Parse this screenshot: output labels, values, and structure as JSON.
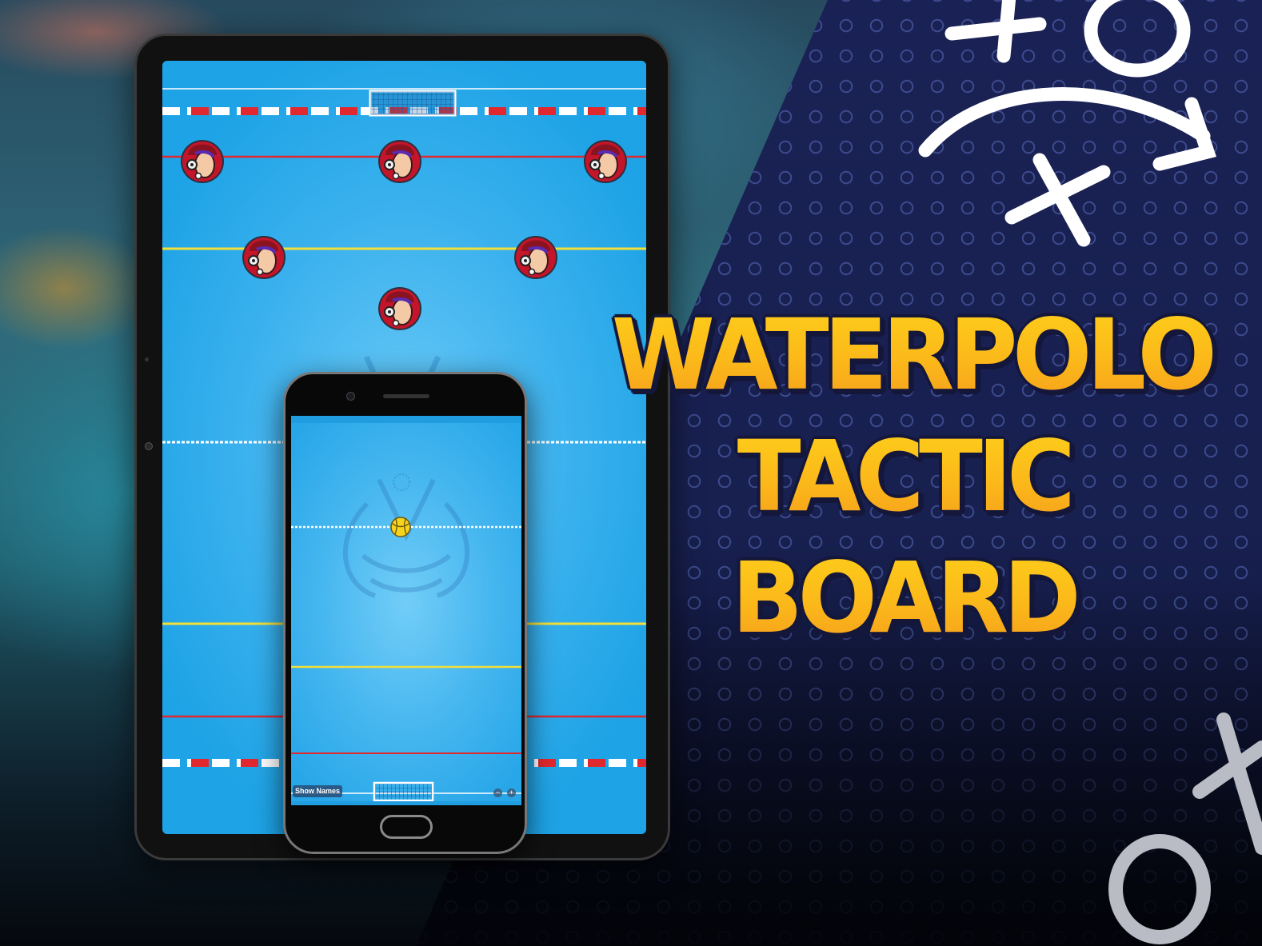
{
  "title": {
    "line1": "WATERPOLO",
    "line2": "TACTIC",
    "line3": "BOARD"
  },
  "phone": {
    "show_names_label": "Show Names",
    "zoom_out_label": "−",
    "zoom_in_label": "+"
  },
  "colors": {
    "pool_blue": "#3cb2ee",
    "navy_panel": "#1b2256",
    "title_yellow": "#ffd21a",
    "title_orange": "#f59a1c",
    "lane_red": "#e0282e",
    "line_yellow": "#f2df3a",
    "cap_red": "#c4152a"
  },
  "icons": [
    "player-cap-icon",
    "water-polo-ball-icon",
    "goal-net-icon",
    "tactic-x-doodle",
    "tactic-o-doodle",
    "tactic-arrow-doodle"
  ]
}
